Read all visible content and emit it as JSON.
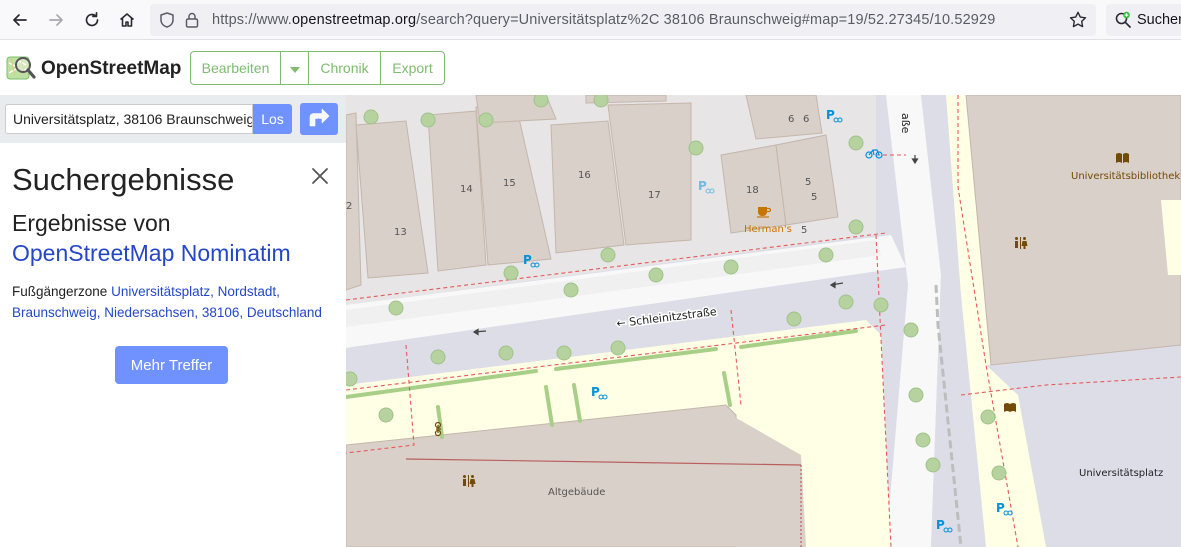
{
  "browser": {
    "url_prefix": "https://www.",
    "url_host": "openstreetmap.org",
    "url_rest": "/search?query=Universitätsplatz%2C 38106 Braunschweig#map=19/52.27345/10.52929",
    "search_label": "Suchen"
  },
  "header": {
    "brand": "OpenStreetMap",
    "edit_label": "Bearbeiten",
    "history_label": "Chronik",
    "export_label": "Export"
  },
  "sidebar": {
    "query_value": "Universitätsplatz, 38106 Braunschweig",
    "go_label": "Los",
    "title": "Suchergebnisse",
    "results_from": "Ergebnisse von",
    "provider": "OpenStreetMap Nominatim",
    "result_type": "Fußgängerzone",
    "result_link": "Universitätsplatz, Nordstadt, Braunschweig, Niedersachsen, 38106, Deutschland",
    "more_label": "Mehr Treffer"
  },
  "map": {
    "street_label": "Schleinitzstraße",
    "street_partial": "aße",
    "cafe_name": "Herman's",
    "library_label": "Universitätsbibliothek",
    "square_label": "Universitätsplatz",
    "building_label": "Altgebäude",
    "house_numbers": [
      "2",
      "13",
      "14",
      "15",
      "16",
      "17",
      "18",
      "5",
      "5",
      "5",
      "6",
      "6"
    ]
  },
  "colors": {
    "accent": "#7092ff",
    "osm_green": "#7ebc6f",
    "link": "#2447c8",
    "building": "#d9d0c9",
    "pedestrian": "#dddde8",
    "university": "#ffffe5"
  }
}
